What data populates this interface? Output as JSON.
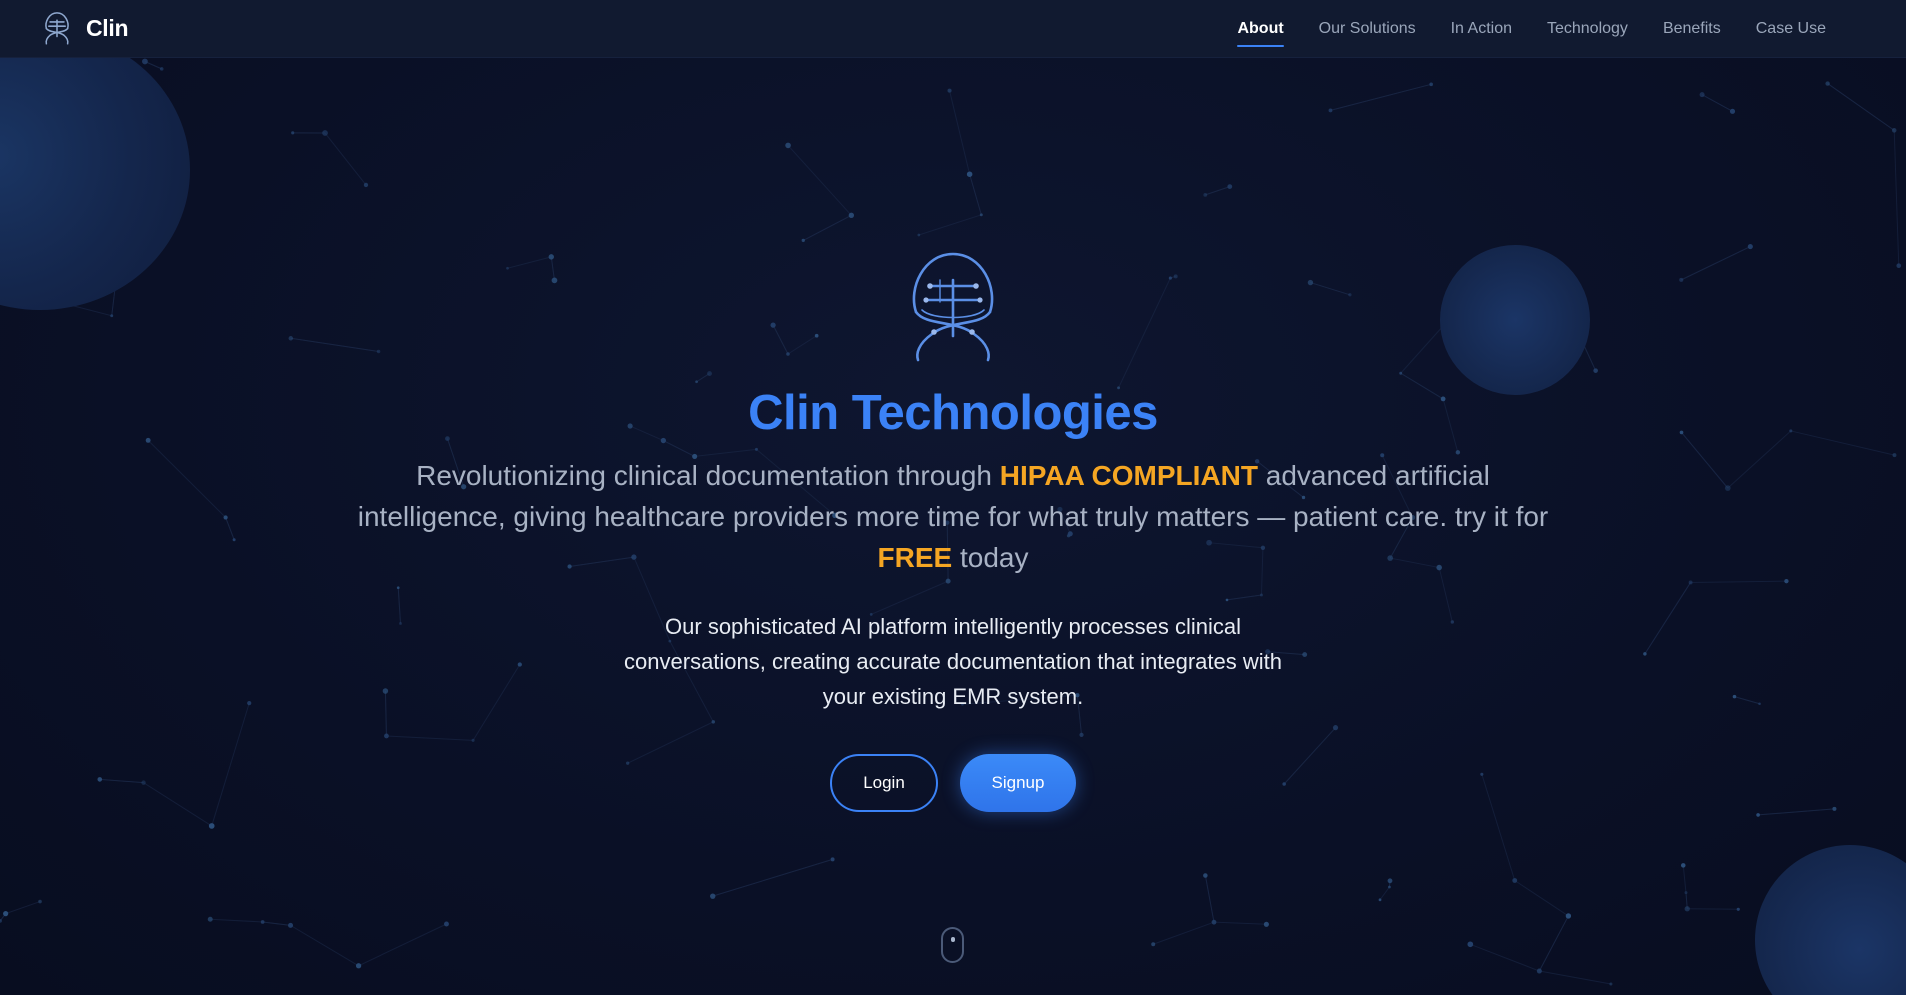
{
  "header": {
    "brand_name": "Clin",
    "brand_icon": "clin-logo-icon",
    "nav": [
      {
        "label": "About",
        "active": true
      },
      {
        "label": "Our Solutions",
        "active": false
      },
      {
        "label": "In Action",
        "active": false
      },
      {
        "label": "Technology",
        "active": false
      },
      {
        "label": "Benefits",
        "active": false
      },
      {
        "label": "Case Use",
        "active": false
      }
    ]
  },
  "hero": {
    "logo_icon": "clin-logo-icon",
    "title": "Clin Technologies",
    "tagline": {
      "part1": "Revolutionizing clinical documentation through ",
      "highlight1": "HIPAA COMPLIANT",
      "part2": " advanced artificial intelligence, giving healthcare providers more time for what truly matters — patient care. try it for ",
      "highlight2": "FREE",
      "part3": " today"
    },
    "description": "Our sophisticated AI platform intelligently processes clinical conversations, creating accurate documentation that integrates with your existing EMR system.",
    "buttons": {
      "login": "Login",
      "signup": "Signup"
    },
    "scroll_icon": "mouse-scroll-icon"
  },
  "colors": {
    "background": "#0b1128",
    "accent": "#3b82f6",
    "highlight": "#f5a623",
    "nav_text": "#9aa6ba"
  }
}
